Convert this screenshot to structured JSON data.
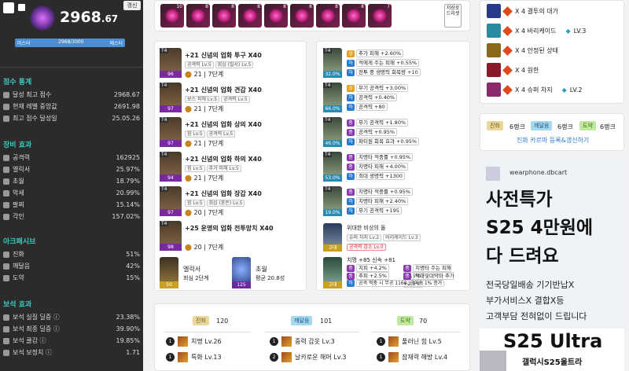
{
  "sidebar": {
    "score": "2968",
    "score_dec": ".67",
    "refresh_btn": "갱신",
    "tier_left": "마스터",
    "tier_progress": "2968/3000",
    "tier_right": "에스터",
    "score_stats": {
      "title": "점수 통계",
      "rows": [
        {
          "label": "달성 최고 점수",
          "value": "2968.67"
        },
        {
          "label": "현재 레벨 중앙값",
          "value": "2691.98"
        },
        {
          "label": "최고 점수 달성일",
          "value": "25.05.26"
        }
      ]
    },
    "equip": {
      "title": "장비 효과",
      "rows": [
        {
          "label": "공격력",
          "value": "162925"
        },
        {
          "label": "엘릭서",
          "value": "25.97%"
        },
        {
          "label": "초월",
          "value": "18.79%"
        },
        {
          "label": "악세",
          "value": "20.99%"
        },
        {
          "label": "팔찌",
          "value": "15.14%"
        },
        {
          "label": "각인",
          "value": "157.02%"
        }
      ]
    },
    "ark": {
      "title": "아크패시브",
      "rows": [
        {
          "label": "진화",
          "value": "51%"
        },
        {
          "label": "깨달음",
          "value": "42%"
        },
        {
          "label": "도약",
          "value": "15%"
        }
      ]
    },
    "gem": {
      "title": "보석 효과",
      "rows": [
        {
          "label": "보석 실질 딜증",
          "value": "23.38%"
        },
        {
          "label": "보석 최종 딜증",
          "value": "39.90%"
        },
        {
          "label": "보석 쿨감",
          "value": "19.85%"
        },
        {
          "label": "보석 보정치",
          "value": "1.71"
        }
      ]
    }
  },
  "gems": {
    "counts": [
      "10",
      "8",
      "8",
      "8",
      "8",
      "8",
      "8",
      "8",
      "7"
    ],
    "side_btn": "저장로드리셋"
  },
  "gear": [
    {
      "tier": "T4",
      "level": "96",
      "name": "+21 신념의 업화 투구 ",
      "mult": "X40",
      "subs": [
        "공격력 Lv.5",
        "회심 (질서) Lv.5"
      ],
      "line": "21 | 7단계"
    },
    {
      "tier": "T4",
      "level": "97",
      "name": "+21 신념의 업화 견갑 ",
      "mult": "X40",
      "subs": [
        "보스 피해 Lv.5",
        "공격력 Lv.5"
      ],
      "line": "21 | 7단계"
    },
    {
      "tier": "T4",
      "level": "97",
      "name": "+21 신념의 업화 상의 ",
      "mult": "X40",
      "subs": [
        "힘 Lv.5",
        "공격력 Lv.5"
      ],
      "line": "21 | 7단계"
    },
    {
      "tier": "T4",
      "level": "94",
      "name": "+21 신념의 업화 하의 ",
      "mult": "X40",
      "subs": [
        "힘 Lv.5",
        "추가 피해 Lv.5"
      ],
      "line": "21 | 7단계"
    },
    {
      "tier": "T4",
      "level": "97",
      "name": "+21 신념의 업화 장갑 ",
      "mult": "X40",
      "subs": [
        "힘 Lv.5",
        "회심 (혼돈) Lv.5"
      ],
      "line": "20 | 7단계"
    },
    {
      "tier": "T4",
      "level": "98",
      "name": "+25 운명의 업화 전투망치 ",
      "mult": "X40",
      "subs": [],
      "line": "20 | 7단계"
    }
  ],
  "elixir": {
    "label": "엘릭서",
    "sub": "회심 2단계",
    "level": "50"
  },
  "trans": {
    "label": "초월",
    "sub": "평균 20.8성",
    "level": "125"
  },
  "acc": [
    {
      "pct": "32.0%",
      "opts": [
        {
          "b": "상",
          "t": "추가 피해 +2.60%"
        },
        {
          "b": "하",
          "t": "적에게 주는 피해 +0.55%"
        },
        {
          "b": "하",
          "t": "전투 중 생명력 회복량 +10"
        }
      ]
    },
    {
      "pct": "66.0%",
      "opts": [
        {
          "b": "상",
          "t": "무기 공격력 +3.00%"
        },
        {
          "b": "하",
          "t": "공격력 +0.40%"
        },
        {
          "b": "하",
          "t": "공격력 +80"
        }
      ]
    },
    {
      "pct": "46.0%",
      "opts": [
        {
          "b": "중",
          "t": "무기 공격력 +1.80%"
        },
        {
          "b": "중",
          "t": "공격력 +0.95%"
        },
        {
          "b": "하",
          "t": "파티원 회복 효과 +0.95%"
        }
      ]
    },
    {
      "pct": "53.0%",
      "opts": [
        {
          "b": "중",
          "t": "치명타 적중률 +0.95%"
        },
        {
          "b": "중",
          "t": "치명타 피해 +4.00%"
        },
        {
          "b": "하",
          "t": "최대 생명력 +1300"
        }
      ]
    },
    {
      "pct": "19.0%",
      "opts": [
        {
          "b": "중",
          "t": "치명타 적중률 +0.95%"
        },
        {
          "b": "하",
          "t": "치명타 피해 +2.40%"
        },
        {
          "b": "하",
          "t": "무기 공격력 +195"
        }
      ]
    }
  ],
  "stone": {
    "grade": "고대",
    "name": "위대한 비상의 돌",
    "subs": [
      "슈퍼 차지 Lv.2",
      "바리케이드 Lv.3"
    ],
    "neg": "공격력 감소 Lv.0"
  },
  "bracelet": {
    "grade": "고대",
    "head": "치명 +85 신속 +81",
    "opts": [
      {
        "b": "중",
        "t": "치피 +4.2%"
      },
      {
        "b": "중",
        "t": "치명타 주는 피해 +1.5%"
      },
      {
        "b": "중",
        "t": "추피 +2.5%"
      },
      {
        "b": "중",
        "t": "악마및대악마 추가 +2.5%"
      },
      {
        "b": "하",
        "t": "공격 적중 시 무공 1160, 공이속 1% 증가"
      }
    ]
  },
  "engravings": [
    {
      "name": "X 4 결투의 대가",
      "lv": ""
    },
    {
      "name": "X 4 바리케이드",
      "lv": "LV.3"
    },
    {
      "name": "X 4 안정된 상태",
      "lv": ""
    },
    {
      "name": "X 4 원한",
      "lv": ""
    },
    {
      "name": "X 4 슈퍼 차지",
      "lv": "LV.2"
    }
  ],
  "rank": {
    "evo": "진화",
    "evo_r": "6랭크",
    "enl": "깨달음",
    "enl_r": "6랭크",
    "leap": "도약",
    "leap_r": "6랭크",
    "link": "진화 카르마 등록&갱신하기"
  },
  "arkpanel": {
    "evo": "진화",
    "evo_v": "120",
    "enl": "깨달음",
    "enl_v": "101",
    "leap": "도약",
    "leap_v": "70",
    "cols": [
      [
        {
          "n": "1",
          "t": "치명 Lv.26"
        },
        {
          "n": "1",
          "t": "특화 Lv.13"
        }
      ],
      [
        {
          "n": "1",
          "t": "중력 갑옷 Lv.3"
        },
        {
          "n": "2",
          "t": "날카로운 해머 Lv.3"
        }
      ],
      [
        {
          "n": "1",
          "t": "풀러닌 힘 Lv.5"
        },
        {
          "n": "1",
          "t": "잠재력 해방 Lv.4"
        }
      ]
    ]
  },
  "ad": {
    "site": "wearphone.dbcart",
    "l1": "사전특가",
    "l2": "S25 4만원에",
    "l3": "다 드려요",
    "s1": "전국당일배송 기기반납X",
    "s2": "부가서비스X 결합X등",
    "s3": "고객부담 전혀없이 드립니다",
    "banner": "S25 Ultra",
    "banner_sub": "갤럭시S25울트라"
  }
}
